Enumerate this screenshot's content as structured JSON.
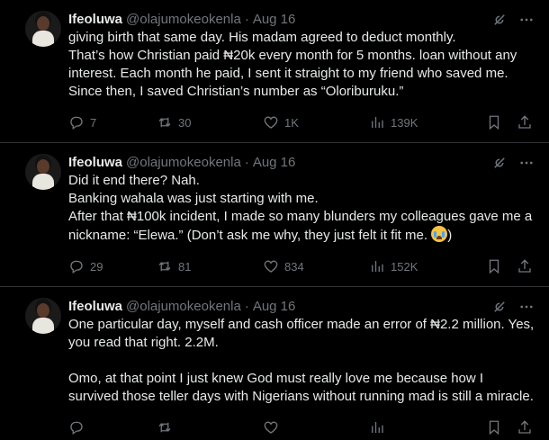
{
  "tweets": [
    {
      "author": "Ifeoluwa",
      "handle": "@olajumokeokenla",
      "date": "Aug 16",
      "text": "giving birth that same day. His madam agreed to deduct monthly.\nThat’s how Christian paid ₦20k every month for 5 months. loan without any interest. Each month he paid, I sent it straight to my friend who saved me. Since then, I saved Christian’s number as “Oloriburuku.”",
      "replies": "7",
      "reposts": "30",
      "likes": "1K",
      "views": "139K"
    },
    {
      "author": "Ifeoluwa",
      "handle": "@olajumokeokenla",
      "date": "Aug 16",
      "text_main": "Did it end there? Nah.\nBanking wahala was just starting with me.\nAfter that ₦100k incident, I made so many blunders my colleagues gave me a nickname: “Elewa.” (Don’t ask me why, they just felt it fit me. ",
      "text_tail": ")",
      "emoji": "loudly-crying-face",
      "replies": "29",
      "reposts": "81",
      "likes": "834",
      "views": "152K"
    },
    {
      "author": "Ifeoluwa",
      "handle": "@olajumokeokenla",
      "date": "Aug 16",
      "text": "One particular day, myself and cash officer made an error of ₦2.2 million. Yes, you read that right. 2.2M.\n\nOmo, at that point I just knew God must really love me because how I survived those teller days with Nigerians without running mad is still a miracle.",
      "replies": "",
      "reposts": "",
      "likes": "",
      "views": ""
    }
  ],
  "icons": {
    "reply": "reply-icon",
    "repost": "repost-icon",
    "like": "heart-icon",
    "views": "views-chart-icon",
    "bookmark": "bookmark-icon",
    "share": "share-icon",
    "grok": "grok-icon",
    "more": "more-icon"
  },
  "colors": {
    "background": "#000000",
    "text": "#e7e9ea",
    "muted": "#71767b",
    "divider": "#2f3336"
  }
}
